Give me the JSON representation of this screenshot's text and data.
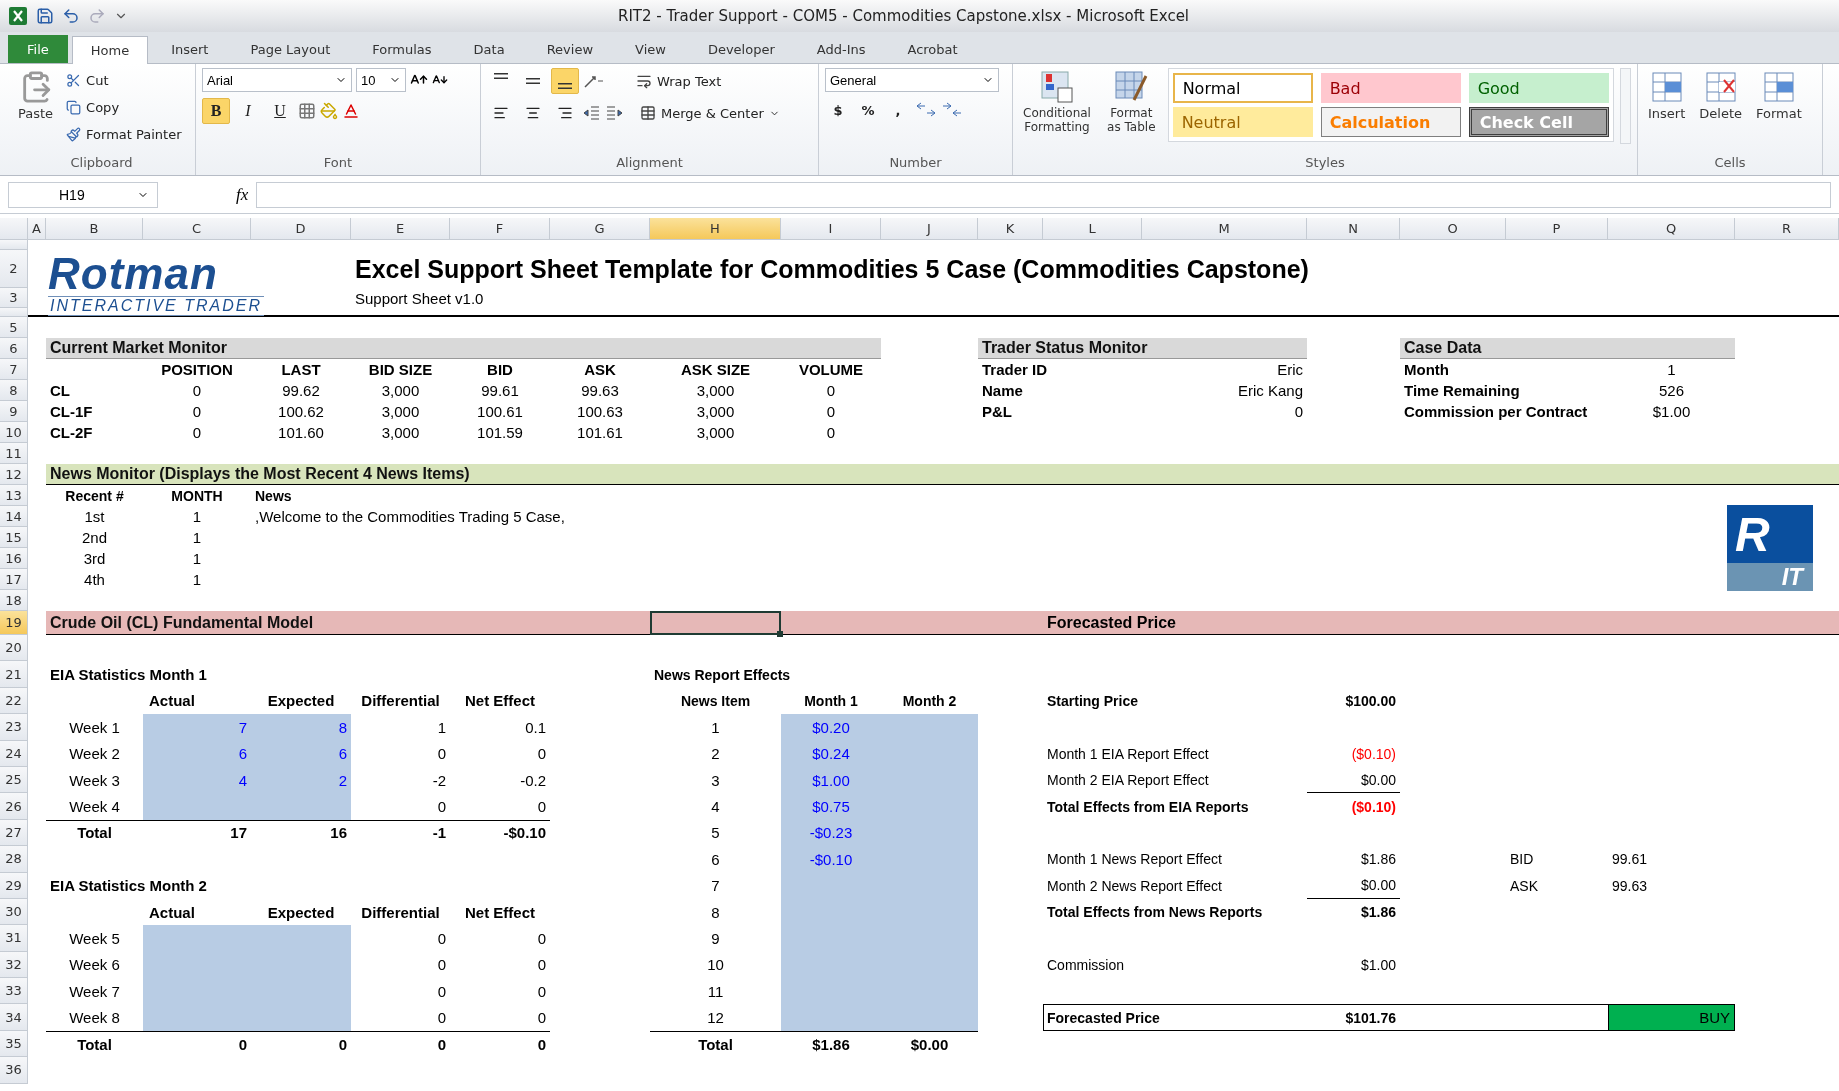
{
  "window": {
    "title": "RIT2 - Trader Support - COM5 - Commodities Capstone.xlsx  -  Microsoft Excel"
  },
  "tabs": [
    {
      "label": "File",
      "kind": "file",
      "selected": false
    },
    {
      "label": "Home",
      "kind": "tab",
      "selected": true
    },
    {
      "label": "Insert",
      "kind": "tab",
      "selected": false
    },
    {
      "label": "Page Layout",
      "kind": "tab",
      "selected": false
    },
    {
      "label": "Formulas",
      "kind": "tab",
      "selected": false
    },
    {
      "label": "Data",
      "kind": "tab",
      "selected": false
    },
    {
      "label": "Review",
      "kind": "tab",
      "selected": false
    },
    {
      "label": "View",
      "kind": "tab",
      "selected": false
    },
    {
      "label": "Developer",
      "kind": "tab",
      "selected": false
    },
    {
      "label": "Add-Ins",
      "kind": "tab",
      "selected": false
    },
    {
      "label": "Acrobat",
      "kind": "tab",
      "selected": false
    }
  ],
  "ribbon": {
    "clipboard": {
      "label": "Clipboard",
      "paste": "Paste",
      "commands": [
        "Cut",
        "Copy",
        "Format Painter"
      ]
    },
    "font": {
      "label": "Font",
      "font_name": "Arial",
      "font_size": "10",
      "styles": [
        {
          "label": "B",
          "on": true
        },
        {
          "label": "I",
          "on": false
        },
        {
          "label": "U",
          "on": false
        }
      ]
    },
    "alignment": {
      "label": "Alignment",
      "vertical": [
        {
          "kind": "top",
          "on": false
        },
        {
          "kind": "middle",
          "on": false
        },
        {
          "kind": "bottom",
          "on": true
        }
      ],
      "horizontal": [
        {
          "kind": "left",
          "on": false
        },
        {
          "kind": "center",
          "on": false
        },
        {
          "kind": "right",
          "on": false
        }
      ],
      "wrap_text": "Wrap Text",
      "merge": "Merge & Center"
    },
    "number": {
      "label": "Number",
      "format": "General",
      "symbols": [
        "$",
        "%",
        ","
      ]
    },
    "styles": {
      "label": "Styles",
      "commands": [
        "Conditional Formatting",
        "Format as Table"
      ],
      "gallery": [
        {
          "label": "Normal",
          "kind": "normal"
        },
        {
          "label": "Bad",
          "kind": "bad"
        },
        {
          "label": "Good",
          "kind": "good"
        },
        {
          "label": "Neutral",
          "kind": "neutral"
        },
        {
          "label": "Calculation",
          "kind": "calculation"
        },
        {
          "label": "Check Cell",
          "kind": "check"
        }
      ]
    },
    "cells": {
      "label": "Cells",
      "commands": [
        "Insert",
        "Delete",
        "Format"
      ]
    }
  },
  "formula_bar": {
    "name_box": "H19",
    "function_label": "fx"
  },
  "columns": [
    {
      "label": "A",
      "selected": false
    },
    {
      "label": "B",
      "selected": false
    },
    {
      "label": "C",
      "selected": false
    },
    {
      "label": "D",
      "selected": false
    },
    {
      "label": "E",
      "selected": false
    },
    {
      "label": "F",
      "selected": false
    },
    {
      "label": "G",
      "selected": false
    },
    {
      "label": "H",
      "selected": true
    },
    {
      "label": "I",
      "selected": false
    },
    {
      "label": "J",
      "selected": false
    },
    {
      "label": "K",
      "selected": false
    },
    {
      "label": "L",
      "selected": false
    },
    {
      "label": "M",
      "selected": false
    },
    {
      "label": "N",
      "selected": false
    },
    {
      "label": "O",
      "selected": false
    },
    {
      "label": "P",
      "selected": false
    },
    {
      "label": "Q",
      "selected": false
    },
    {
      "label": "R",
      "selected": false
    }
  ],
  "row_numbers": [
    {
      "label": "2",
      "selected": false
    },
    {
      "label": "3",
      "selected": false
    },
    {
      "label": "5",
      "selected": false
    },
    {
      "label": "6",
      "selected": false
    },
    {
      "label": "7",
      "selected": false
    },
    {
      "label": "8",
      "selected": false
    },
    {
      "label": "9",
      "selected": false
    },
    {
      "label": "10",
      "selected": false
    },
    {
      "label": "11",
      "selected": false
    },
    {
      "label": "12",
      "selected": false
    },
    {
      "label": "13",
      "selected": false
    },
    {
      "label": "14",
      "selected": false
    },
    {
      "label": "15",
      "selected": false
    },
    {
      "label": "16",
      "selected": false
    },
    {
      "label": "17",
      "selected": false
    },
    {
      "label": "18",
      "selected": false
    },
    {
      "label": "19",
      "selected": true
    },
    {
      "label": "20",
      "selected": false
    },
    {
      "label": "21",
      "selected": false
    },
    {
      "label": "22",
      "selected": false
    },
    {
      "label": "23",
      "selected": false
    },
    {
      "label": "24",
      "selected": false
    },
    {
      "label": "25",
      "selected": false
    },
    {
      "label": "26",
      "selected": false
    },
    {
      "label": "27",
      "selected": false
    },
    {
      "label": "28",
      "selected": false
    },
    {
      "label": "29",
      "selected": false
    },
    {
      "label": "30",
      "selected": false
    },
    {
      "label": "31",
      "selected": false
    },
    {
      "label": "32",
      "selected": false
    },
    {
      "label": "33",
      "selected": false
    },
    {
      "label": "34",
      "selected": false
    },
    {
      "label": "35",
      "selected": false
    },
    {
      "label": "36",
      "selected": false
    }
  ],
  "logo": {
    "wordmark": "Rotman",
    "tagline": "INTERACTIVE TRADER"
  },
  "sheet_title": "Excel Support Sheet Template for Commodities 5 Case (Commodities Capstone)",
  "sheet_subtitle": "Support Sheet v1.0",
  "market_monitor": {
    "title": "Current Market Monitor",
    "columns": [
      "POSITION",
      "LAST",
      "BID SIZE",
      "BID",
      "ASK",
      "ASK SIZE",
      "VOLUME"
    ],
    "rows": [
      {
        "symbol": "CL",
        "values": [
          "0",
          "99.62",
          "3,000",
          "99.61",
          "99.63",
          "3,000",
          "0"
        ]
      },
      {
        "symbol": "CL-1F",
        "values": [
          "0",
          "100.62",
          "3,000",
          "100.61",
          "100.63",
          "3,000",
          "0"
        ]
      },
      {
        "symbol": "CL-2F",
        "values": [
          "0",
          "101.60",
          "3,000",
          "101.59",
          "101.61",
          "3,000",
          "0"
        ]
      }
    ]
  },
  "trader_status": {
    "title": "Trader Status Monitor",
    "fields": [
      {
        "label": "Trader ID",
        "value": "Eric"
      },
      {
        "label": "Name",
        "value": "Eric Kang"
      },
      {
        "label": "P&L",
        "value": "0"
      }
    ]
  },
  "case_data": {
    "title": "Case Data",
    "fields": [
      {
        "label": "Month",
        "value": "1"
      },
      {
        "label": "Time Remaining",
        "value": "526"
      },
      {
        "label": "Commission per Contract",
        "value": "$1.00"
      }
    ]
  },
  "news_monitor": {
    "title": "News Monitor (Displays the Most Recent 4 News Items)",
    "columns": [
      "Recent #",
      "MONTH",
      "News"
    ],
    "items": [
      {
        "recent": "1st",
        "month": "1",
        "news": ",Welcome to the Commodities Trading 5 Case,"
      },
      {
        "recent": "2nd",
        "month": "1"
      },
      {
        "recent": "3rd",
        "month": "1"
      },
      {
        "recent": "4th",
        "month": "1"
      }
    ]
  },
  "rit_logo": {
    "top": "R",
    "bottom": "IT"
  },
  "fundamental_model": {
    "title": "Crude Oil (CL) Fundamental Model",
    "forecast_title": "Forecasted Price"
  },
  "eia_tables": [
    {
      "title": "EIA Statistics Month 1",
      "columns": [
        "Actual",
        "Expected",
        "Differential",
        "Net Effect"
      ],
      "rows": [
        {
          "label": "Week 1",
          "actual": "7",
          "expected": "8",
          "differential": "1",
          "net_effect": "0.1"
        },
        {
          "label": "Week 2",
          "actual": "6",
          "expected": "6",
          "differential": "0",
          "net_effect": "0"
        },
        {
          "label": "Week 3",
          "actual": "4",
          "expected": "2",
          "differential": "-2",
          "net_effect": "-0.2"
        },
        {
          "label": "Week 4",
          "differential": "0",
          "net_effect": "0"
        }
      ],
      "total": {
        "label": "Total",
        "actual": "17",
        "expected": "16",
        "differential": "-1",
        "net_effect": "-$0.10"
      }
    },
    {
      "title": "EIA Statistics Month 2",
      "columns": [
        "Actual",
        "Expected",
        "Differential",
        "Net Effect"
      ],
      "rows": [
        {
          "label": "Week 5",
          "differential": "0",
          "net_effect": "0"
        },
        {
          "label": "Week 6",
          "differential": "0",
          "net_effect": "0"
        },
        {
          "label": "Week 7",
          "differential": "0",
          "net_effect": "0"
        },
        {
          "label": "Week 8",
          "differential": "0",
          "net_effect": "0"
        }
      ],
      "total": {
        "label": "Total",
        "actual": "0",
        "expected": "0",
        "differential": "0",
        "net_effect": "0"
      }
    }
  ],
  "news_effects": {
    "title": "News Report Effects",
    "columns": [
      "News Item",
      "Month 1",
      "Month 2"
    ],
    "rows": [
      {
        "item": "1",
        "month_1": "$0.20"
      },
      {
        "item": "2",
        "month_1": "$0.24"
      },
      {
        "item": "3",
        "month_1": "$1.00"
      },
      {
        "item": "4",
        "month_1": "$0.75"
      },
      {
        "item": "5",
        "month_1": "-$0.23"
      },
      {
        "item": "6",
        "month_1": "-$0.10"
      },
      {
        "item": "7"
      },
      {
        "item": "8"
      },
      {
        "item": "9"
      },
      {
        "item": "10"
      },
      {
        "item": "11"
      },
      {
        "item": "12"
      }
    ],
    "total": {
      "label": "Total",
      "month_1": "$1.86",
      "month_2": "$0.00"
    }
  },
  "forecast_lines": [
    {
      "label": "Starting Price",
      "value": "$100.00",
      "bold": true,
      "negative": false,
      "underlined": false
    },
    {
      "label": "Month 1 EIA Report Effect",
      "value": "($0.10)",
      "bold": false,
      "negative": true,
      "underlined": false
    },
    {
      "label": "Month 2 EIA Report Effect",
      "value": "$0.00",
      "bold": false,
      "negative": false,
      "underlined": true
    },
    {
      "label": "Total Effects from EIA Reports",
      "value": "($0.10)",
      "bold": true,
      "negative": true,
      "underlined": false
    },
    {
      "label": "Month 1 News Report Effect",
      "value": "$1.86",
      "bold": false,
      "negative": false,
      "underlined": false
    },
    {
      "label": "Month 2 News Report Effect",
      "value": "$0.00",
      "bold": false,
      "negative": false,
      "underlined": true
    },
    {
      "label": "Total Effects from News Reports",
      "value": "$1.86",
      "bold": true,
      "negative": false,
      "underlined": false
    },
    {
      "label": "Commission",
      "value": "$1.00",
      "bold": false,
      "negative": false,
      "underlined": false
    }
  ],
  "quotes": [
    {
      "label": "BID",
      "value": "99.61"
    },
    {
      "label": "ASK",
      "value": "99.63"
    }
  ],
  "forecast_result": {
    "label": "Forecasted Price",
    "value": "$101.76",
    "signal": "BUY",
    "kind": "buy"
  }
}
